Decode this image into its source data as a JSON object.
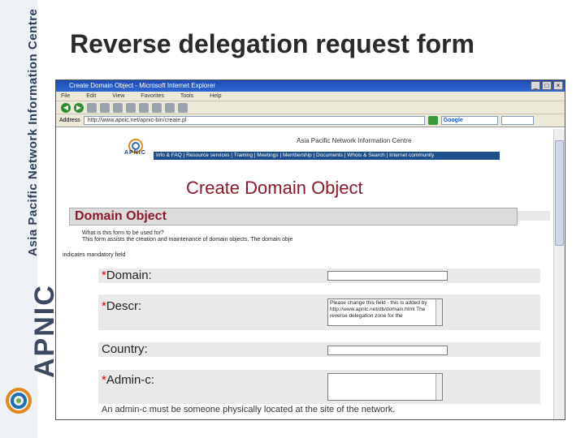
{
  "slide": {
    "title": "Reverse delegation request form",
    "side_text": "Asia Pacific Network Information Centre",
    "side_logo": "APNIC"
  },
  "browser": {
    "window_title": "Create Domain Object - Microsoft Internet Explorer",
    "menu": [
      "File",
      "Edit",
      "View",
      "Favorites",
      "Tools",
      "Help"
    ],
    "address_label": "Address",
    "address_value": "http://www.apnic.net/apnic-bin/create.pl",
    "google_label": "Google"
  },
  "apnic_header": {
    "center_name": "Asia Pacific Network Information Centre",
    "logo_text": "APNIC",
    "nav": "Info & FAQ | Resource services | Training | Meetings | Membership | Documents | Whois & Search | Internet community"
  },
  "page": {
    "heading": "Create Domain Object",
    "section_title": "Domain Object",
    "faq_question": "What is this form to be used for?",
    "faq_answer": "This form assists the creation and maintenance of domain objects. The domain obje",
    "mandatory_note": "indicates mandatory field",
    "fields": [
      {
        "star": "*",
        "label": "Domain:"
      },
      {
        "star": "*",
        "label": "Descr:",
        "value": "Please change this field - this is added by http://www.apnic.net/db/domain.html The reverse delegation zone for the"
      },
      {
        "star": "",
        "label": "Country:"
      },
      {
        "star": "*",
        "label": "Admin-c:"
      }
    ],
    "admin_note": "An admin-c must be someone physically located at the site of the network."
  },
  "colors": {
    "heading": "#8b1a2b",
    "nav_strip": "#1e4f8c",
    "titlebar": "#2f66d0"
  }
}
